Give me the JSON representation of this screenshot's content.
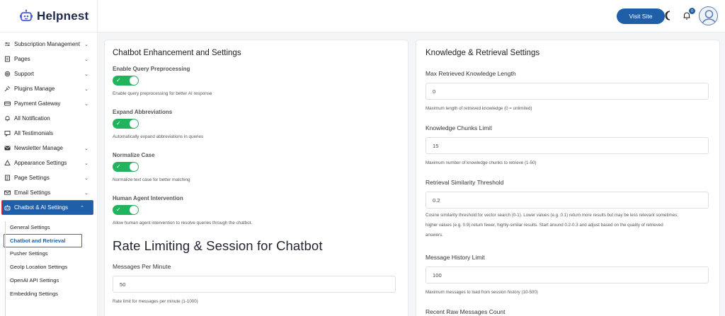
{
  "brand": {
    "name": "Helpnest"
  },
  "sidebar": {
    "items": [
      {
        "label": "Subscription Management",
        "icon": "subscription-icon",
        "chevron": true
      },
      {
        "label": "Pages",
        "icon": "pages-icon",
        "chevron": true
      },
      {
        "label": "Support",
        "icon": "support-icon",
        "chevron": true
      },
      {
        "label": "Plugins Manage",
        "icon": "plugin-icon",
        "chevron": true
      },
      {
        "label": "Payment Gateway",
        "icon": "payment-icon",
        "chevron": true
      },
      {
        "label": "All Notification",
        "icon": "bell-icon",
        "chevron": false
      },
      {
        "label": "All Testimonials",
        "icon": "testimonial-icon",
        "chevron": false
      },
      {
        "label": "Newsletter Manage",
        "icon": "newsletter-icon",
        "chevron": true
      },
      {
        "label": "Appearance Settings",
        "icon": "appearance-icon",
        "chevron": true
      },
      {
        "label": "Page Settings",
        "icon": "page-settings-icon",
        "chevron": true
      },
      {
        "label": "Email Settings",
        "icon": "email-icon",
        "chevron": true
      },
      {
        "label": "Chatbot & AI Settings",
        "icon": "chatbot-icon",
        "chevron": true,
        "active": true
      }
    ],
    "subitems": [
      {
        "label": "General Settings"
      },
      {
        "label": "Chatbot and Retrieval",
        "current": true
      },
      {
        "label": "Pusher Settings"
      },
      {
        "label": "GeoIp Location Settings"
      },
      {
        "label": "OpenAI API Settings"
      },
      {
        "label": "Embedding Settings"
      }
    ]
  },
  "header": {
    "visit_site": "Visit Site",
    "notification_count": "0"
  },
  "left_card": {
    "title": "Chatbot Enhancement and Settings",
    "toggles": [
      {
        "label": "Enable Query Preprocessing",
        "help": "Enable query preprocessing for better AI response",
        "on": true
      },
      {
        "label": "Expand Abbreviations",
        "help": "Automatically expand abbreviations in queries",
        "on": true
      },
      {
        "label": "Normalize Case",
        "help": "Normalize text case for better matching",
        "on": true
      },
      {
        "label": "Human Agent Intervention",
        "help": "Allow human agent intervention to resolve queries through the chatbot.",
        "on": true
      }
    ],
    "rate_heading": "Rate Limiting & Session for Chatbot",
    "messages_per_minute": {
      "label": "Messages Per Minute",
      "value": "50",
      "help": "Rate limit for messages per minute (1-1000)"
    }
  },
  "right_card": {
    "title": "Knowledge & Retrieval Settings",
    "fields": [
      {
        "label": "Max Retrieved Knowledge Length",
        "value": "0",
        "help": [
          "Maximum length of retrieved knowledge (0 = unlimited)"
        ]
      },
      {
        "label": "Knowledge Chunks Limit",
        "value": "15",
        "help": [
          "Maximum number of knowledge chunks to retrieve (1-50)"
        ]
      },
      {
        "label": "Retrieval Similarity Threshold",
        "value": "0.2",
        "help": [
          "Cosine similarity threshold for vector search (0-1). Lower values (e.g. 0.1) return more results but may be less relevant sometimes;",
          "higher values (e.g. 0.9) return fewer, highly-similar results. Start around 0.2-0.3 and adjust based on the quality of retrieved",
          "answers."
        ]
      },
      {
        "label": "Message History Limit",
        "value": "100",
        "help": [
          "Maximum messages to load from session history (10-500)"
        ]
      },
      {
        "label": "Recent Raw Messages Count",
        "value": "",
        "help": []
      }
    ]
  },
  "colors": {
    "primary": "#1f5fa8",
    "toggle_on": "#22b35e",
    "highlight_border": "#e0302f"
  }
}
